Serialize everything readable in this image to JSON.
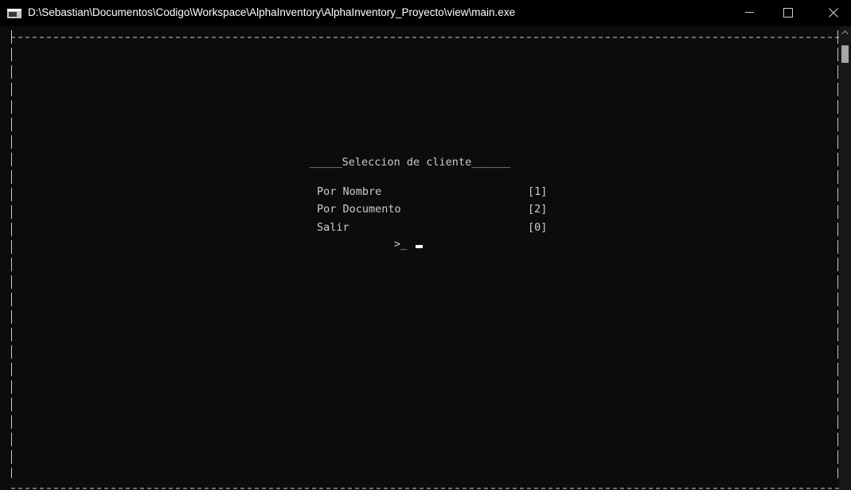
{
  "window": {
    "title": "D:\\Sebastian\\Documentos\\Codigo\\Workspace\\AlphaInventory\\AlphaInventory_Proyecto\\view\\main.exe"
  },
  "icons": {
    "app": "console-app-icon",
    "minimize": "minimize-icon",
    "maximize": "maximize-icon",
    "close": "close-icon",
    "scroll_up": "chevron-up-icon"
  },
  "console": {
    "menu_title": "_____Seleccion de cliente______",
    "options": [
      {
        "label": "Por Nombre",
        "key": "[1]"
      },
      {
        "label": "Por Documento",
        "key": "[2]"
      },
      {
        "label": "Salir",
        "key": "[0]"
      }
    ],
    "prompt": ">_"
  },
  "colors": {
    "background": "#0c0c0c",
    "text": "#cccccc",
    "titlebar": "#000000"
  }
}
